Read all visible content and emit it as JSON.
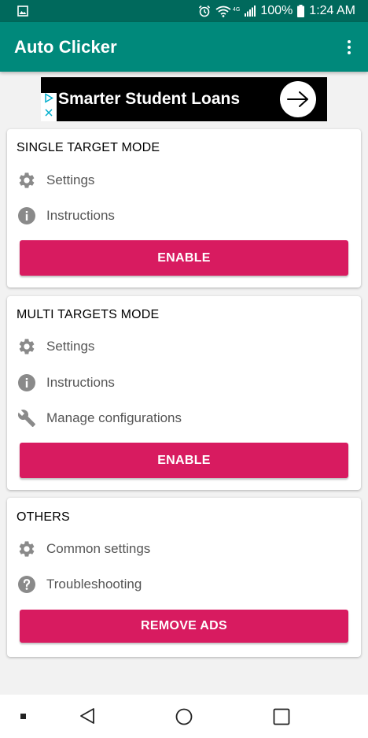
{
  "status_bar": {
    "battery": "100%",
    "time": "1:24 AM",
    "network": "4G",
    "icons": [
      "gallery-icon",
      "alarm-icon",
      "wifi-icon",
      "signal-icon",
      "battery-icon"
    ]
  },
  "app_bar": {
    "title": "Auto Clicker",
    "overflow_icon": "more-vert-icon"
  },
  "ad": {
    "text": "Smarter Student Loans",
    "icons": [
      "ad-choices-icon",
      "ad-close-icon",
      "arrow-right-icon"
    ]
  },
  "single_target": {
    "title": "SINGLE TARGET MODE",
    "settings_label": "Settings",
    "instructions_label": "Instructions",
    "enable_label": "ENABLE"
  },
  "multi_targets": {
    "title": "MULTI TARGETS MODE",
    "settings_label": "Settings",
    "instructions_label": "Instructions",
    "manage_label": "Manage configurations",
    "enable_label": "ENABLE"
  },
  "others": {
    "title": "OTHERS",
    "common_settings_label": "Common settings",
    "troubleshooting_label": "Troubleshooting",
    "remove_ads_label": "REMOVE ADS"
  },
  "nav_bar": {
    "icons": [
      "recent-dot-icon",
      "back-icon",
      "home-icon",
      "overview-icon"
    ]
  },
  "colors": {
    "status_bar": "#00695c",
    "app_bar": "#00897b",
    "accent": "#d81b60",
    "background": "#f2f2f2",
    "icon_grey": "#8a8a8a"
  }
}
